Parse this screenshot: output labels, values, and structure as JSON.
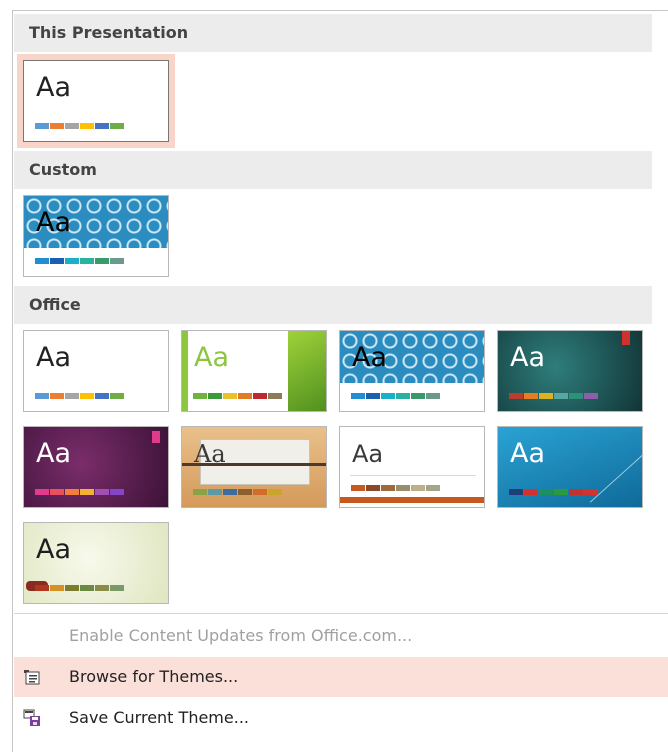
{
  "sections": {
    "this_presentation": "This Presentation",
    "custom": "Custom",
    "office": "Office"
  },
  "theme_label": "Aa",
  "menu": {
    "enable_updates": "Enable Content Updates from Office.com...",
    "browse": "Browse for Themes...",
    "save": "Save Current Theme..."
  },
  "colors": {
    "selected_border": "#f9d4c8",
    "hover_bg": "#fbe0da",
    "header_bg": "#ececec",
    "pattern_blue": "#2a8cbf"
  },
  "icons": {
    "browse": "browse-themes-icon",
    "save": "save-theme-icon"
  }
}
